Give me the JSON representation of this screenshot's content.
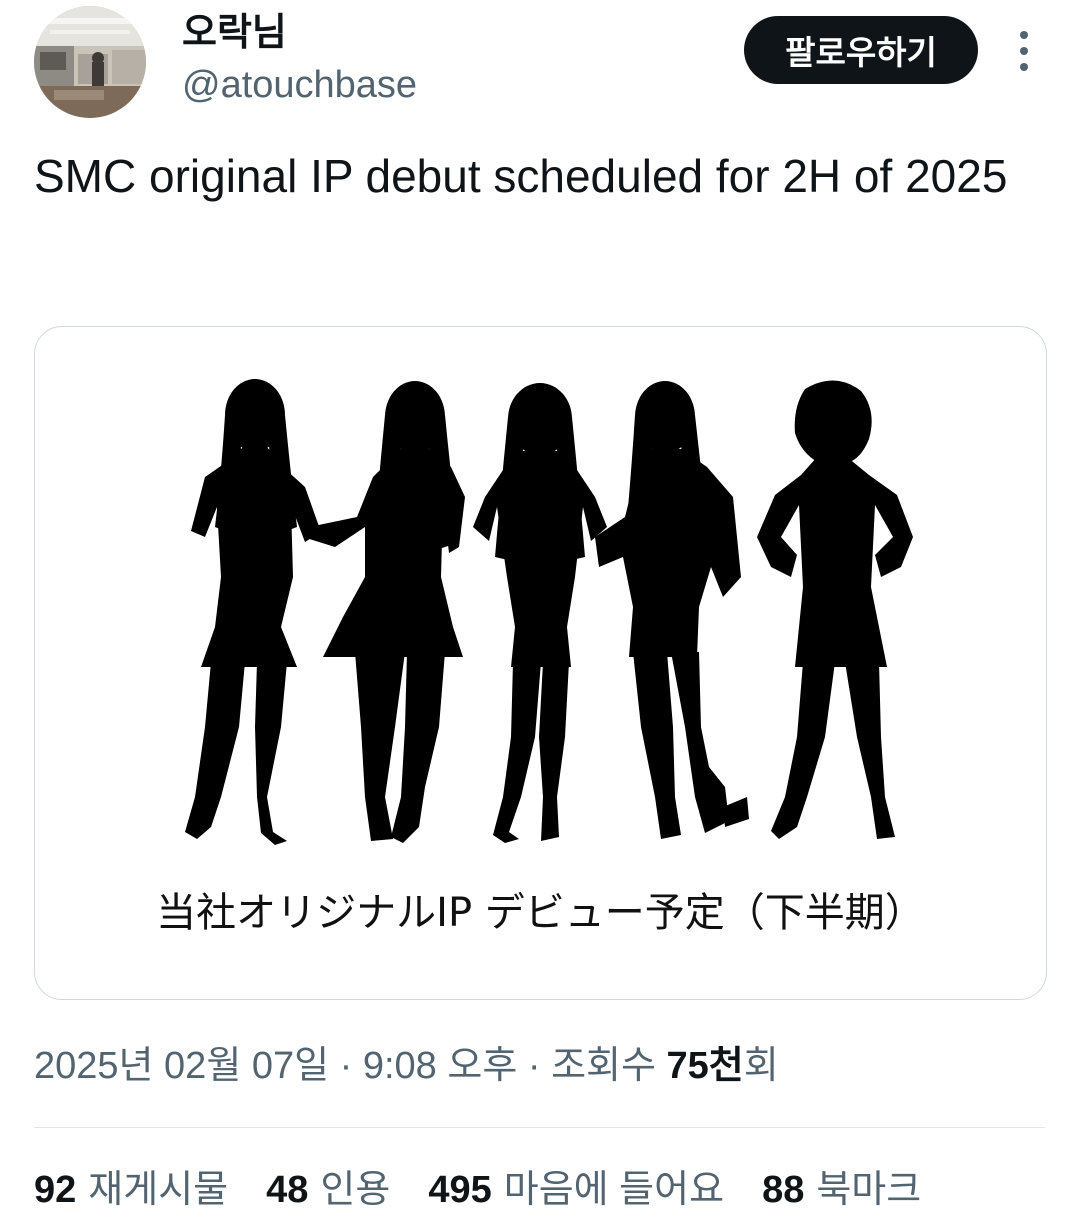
{
  "user": {
    "display_name": "오락님",
    "handle": "@atouchbase",
    "follow_label": "팔로우하기",
    "avatar_icon": "office-photo-avatar",
    "more_icon": "more-vertical-icon"
  },
  "tweet": {
    "text": "SMC original IP debut scheduled for 2H of 2025",
    "media": {
      "caption": "当社オリジナルIP デビュー予定（下半期）",
      "image_icon": "five-women-silhouette-image"
    },
    "meta": {
      "date": "2025년 02월 07일",
      "separator": "·",
      "time": "9:08 오후",
      "views_label": "조회수",
      "views_value": "75천",
      "views_suffix": "회"
    },
    "stats": {
      "reposts": {
        "value": "92",
        "label": "재게시물"
      },
      "quotes": {
        "value": "48",
        "label": "인용"
      },
      "likes": {
        "value": "495",
        "label": "마음에 들어요"
      },
      "bookmarks": {
        "value": "88",
        "label": "북마크"
      }
    }
  },
  "colors": {
    "text_primary": "#0f1419",
    "text_secondary": "#536471",
    "border": "#cfd9de",
    "button_bg": "#0f1419"
  }
}
